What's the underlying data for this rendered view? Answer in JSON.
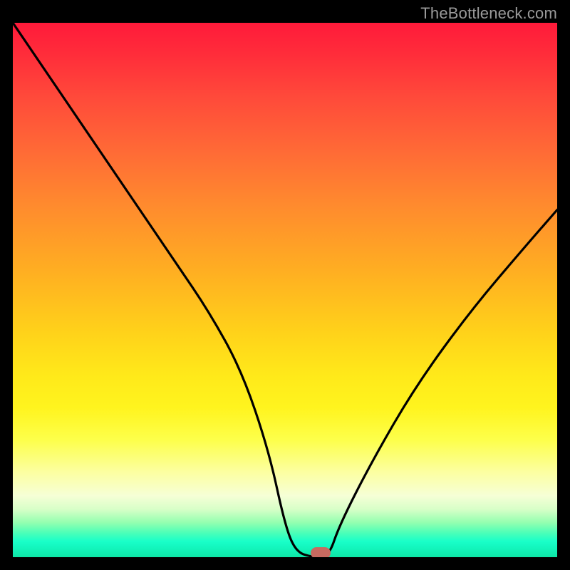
{
  "watermark": "TheBottleneck.com",
  "chart_data": {
    "type": "line",
    "title": "",
    "xlabel": "",
    "ylabel": "",
    "xlim": [
      0,
      100
    ],
    "ylim": [
      0,
      100
    ],
    "grid": false,
    "series": [
      {
        "name": "bottleneck-curve",
        "x": [
          0,
          6,
          12,
          18,
          24,
          30,
          36,
          42,
          47,
          50,
          52,
          55,
          58,
          60,
          66,
          74,
          84,
          94,
          100
        ],
        "values": [
          100,
          91,
          82,
          73,
          64,
          55,
          46,
          35,
          20,
          6,
          1,
          0,
          0,
          6,
          18,
          32,
          46,
          58,
          65
        ]
      }
    ],
    "annotations": [
      {
        "name": "optimal-marker",
        "x": 56.5,
        "y": 0.8
      }
    ],
    "gradient_stops": [
      {
        "pos": 0,
        "color": "#ff1a3a"
      },
      {
        "pos": 0.5,
        "color": "#ffd21a"
      },
      {
        "pos": 0.85,
        "color": "#fcffa0"
      },
      {
        "pos": 1.0,
        "color": "#0ee6a6"
      }
    ]
  }
}
